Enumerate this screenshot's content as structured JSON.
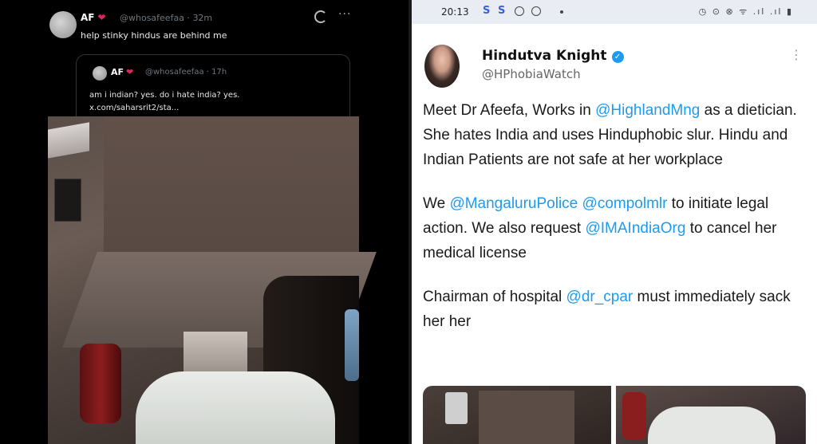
{
  "left_tweet": {
    "name": "AF",
    "handle": "@whosafeefaa",
    "time": "32m",
    "text": "help stinky hindus are behind me",
    "more": "···",
    "quoted": {
      "name": "AF",
      "handle": "@whosafeefaa",
      "time": "17h",
      "text_line1": "am i indian? yes. do i hate india? yes.",
      "text_line2": "x.com/saharsrit2/sta..."
    }
  },
  "right_post": {
    "status_bar": {
      "time": "20:13",
      "letters": [
        "S",
        "S"
      ],
      "right_icons": "◷ ⊙ ⊗ ᯤ .ıl .ıl ▮"
    },
    "author": {
      "name": "Hindutva Knight",
      "handle": "@HPhobiaWatch",
      "verified_symbol": "✓"
    },
    "more": "⋮",
    "paragraph1": {
      "t1": "Meet Dr Afeefa, Works in ",
      "m1": "@HighlandMng",
      "t2": " as a dietician. She hates India and uses Hinduphobic slur. Hindu and Indian Patients are not safe at her workplace"
    },
    "paragraph2": {
      "t1": "We ",
      "m1": "@MangaluruPolice",
      "t2": " ",
      "m2": "@compolmlr",
      "t3": " to initiate legal action. We also request ",
      "m3": "@IMAIndiaOrg",
      "t4": " to cancel her medical license"
    },
    "paragraph3": {
      "t1": "Chairman of hospital ",
      "m1": "@dr_cpar",
      "t2": " must immediately sack her her"
    }
  },
  "colors": {
    "mention": "#1d9bf0",
    "heart": "#e0245e",
    "status_accent": "#3a62d6"
  }
}
